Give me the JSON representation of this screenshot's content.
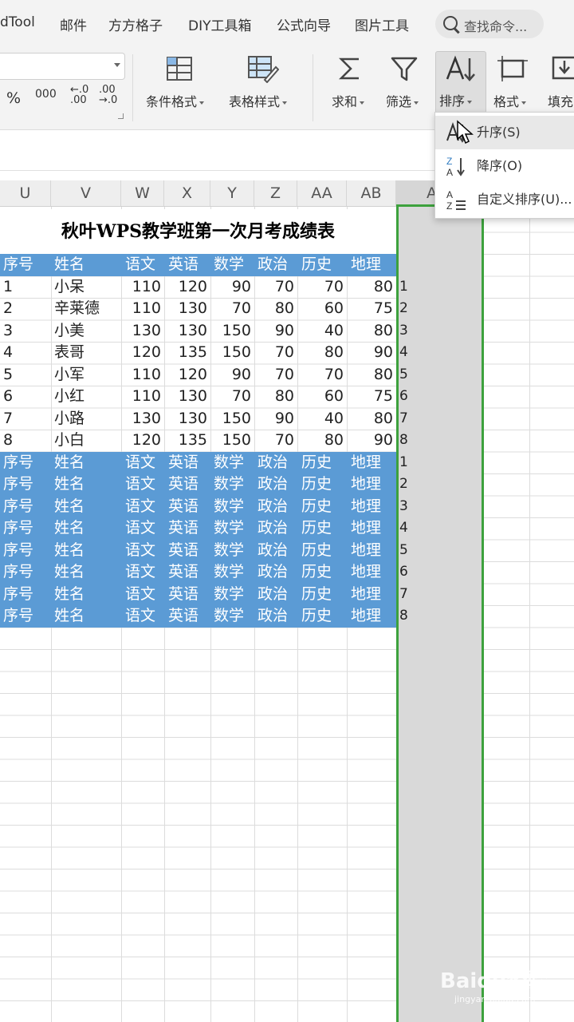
{
  "menu_tabs": [
    "dTool",
    "邮件",
    "方方格子",
    "DIY工具箱",
    "公式向导",
    "图片工具"
  ],
  "search": {
    "placeholder": "查找命令..."
  },
  "number_format": {
    "percent": "%",
    "thousands": "000",
    "inc_decimal": "←.0\n.00",
    "dec_decimal": ".00\n→.0"
  },
  "ribbon": {
    "conditional_format": "条件格式",
    "table_style": "表格样式",
    "sum": "求和",
    "filter": "筛选",
    "sort": "排序",
    "format": "格式",
    "fill": "填充"
  },
  "sort_menu": {
    "ascending": "升序(S)",
    "descending": "降序(O)",
    "custom": "自定义排序(U)..."
  },
  "columns": [
    "U",
    "V",
    "W",
    "X",
    "Y",
    "Z",
    "AA",
    "AB",
    "A"
  ],
  "sheet_title": "秋叶WPS教学班第一次月考成绩表",
  "header": [
    "序号",
    "姓名",
    "语文",
    "英语",
    "数学",
    "政治",
    "历史",
    "地理"
  ],
  "rows": [
    [
      "1",
      "小呆",
      "110",
      "120",
      "90",
      "70",
      "70",
      "80"
    ],
    [
      "2",
      "辛莱德",
      "110",
      "130",
      "70",
      "80",
      "60",
      "75"
    ],
    [
      "3",
      "小美",
      "130",
      "130",
      "150",
      "90",
      "40",
      "80"
    ],
    [
      "4",
      "表哥",
      "120",
      "135",
      "150",
      "70",
      "80",
      "90"
    ],
    [
      "5",
      "小军",
      "110",
      "120",
      "90",
      "70",
      "70",
      "80"
    ],
    [
      "6",
      "小红",
      "110",
      "130",
      "70",
      "80",
      "60",
      "75"
    ],
    [
      "7",
      "小路",
      "130",
      "130",
      "150",
      "90",
      "40",
      "80"
    ],
    [
      "8",
      "小白",
      "120",
      "135",
      "150",
      "70",
      "80",
      "90"
    ]
  ],
  "helper_index": [
    "1",
    "2",
    "3",
    "4",
    "5",
    "6",
    "7",
    "8",
    "1",
    "2",
    "3",
    "4",
    "5",
    "6",
    "7",
    "8"
  ],
  "watermark": {
    "brand": "Baidu经验",
    "url": "jingyan.baidu.com"
  },
  "colors": {
    "header_fill": "#5b9bd5",
    "selection_border": "#3da13d",
    "selected_column": "#d9d9d9"
  }
}
